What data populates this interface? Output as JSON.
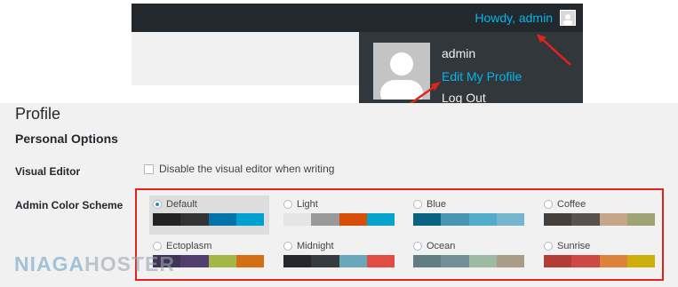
{
  "admin_bar": {
    "greeting": "Howdy, admin",
    "dropdown": {
      "username": "admin",
      "edit_profile": "Edit My Profile",
      "logout": "Log Out"
    }
  },
  "profile": {
    "title": "Profile",
    "section": "Personal Options",
    "visual_editor": {
      "label": "Visual Editor",
      "checkbox_label": "Disable the visual editor when writing",
      "checked": false
    },
    "color_scheme": {
      "label": "Admin Color Scheme",
      "selected": "Default",
      "schemes": [
        {
          "name": "Default",
          "colors": [
            "#222222",
            "#333333",
            "#0073aa",
            "#00a0d2"
          ]
        },
        {
          "name": "Light",
          "colors": [
            "#e5e5e5",
            "#999999",
            "#d64e07",
            "#04a4cc"
          ]
        },
        {
          "name": "Blue",
          "colors": [
            "#096484",
            "#4796b3",
            "#52accc",
            "#74b6ce"
          ]
        },
        {
          "name": "Coffee",
          "colors": [
            "#46403c",
            "#59524c",
            "#c7a589",
            "#9ea476"
          ]
        },
        {
          "name": "Ectoplasm",
          "colors": [
            "#413256",
            "#523f6d",
            "#a3b745",
            "#d46f15"
          ]
        },
        {
          "name": "Midnight",
          "colors": [
            "#25282b",
            "#363b3f",
            "#69a8bb",
            "#e14d43"
          ]
        },
        {
          "name": "Ocean",
          "colors": [
            "#627c83",
            "#738e96",
            "#9ebaa0",
            "#aa9d88"
          ]
        },
        {
          "name": "Sunrise",
          "colors": [
            "#b43c38",
            "#cf4944",
            "#dd823b",
            "#ccaf0b"
          ]
        }
      ]
    }
  },
  "watermark": {
    "part1": "NIAGA",
    "part2": "HOSTER"
  },
  "colors": {
    "annotation_red": "#e1251b",
    "link_blue": "#00b9eb",
    "admin_bar_bg": "#23282d"
  }
}
